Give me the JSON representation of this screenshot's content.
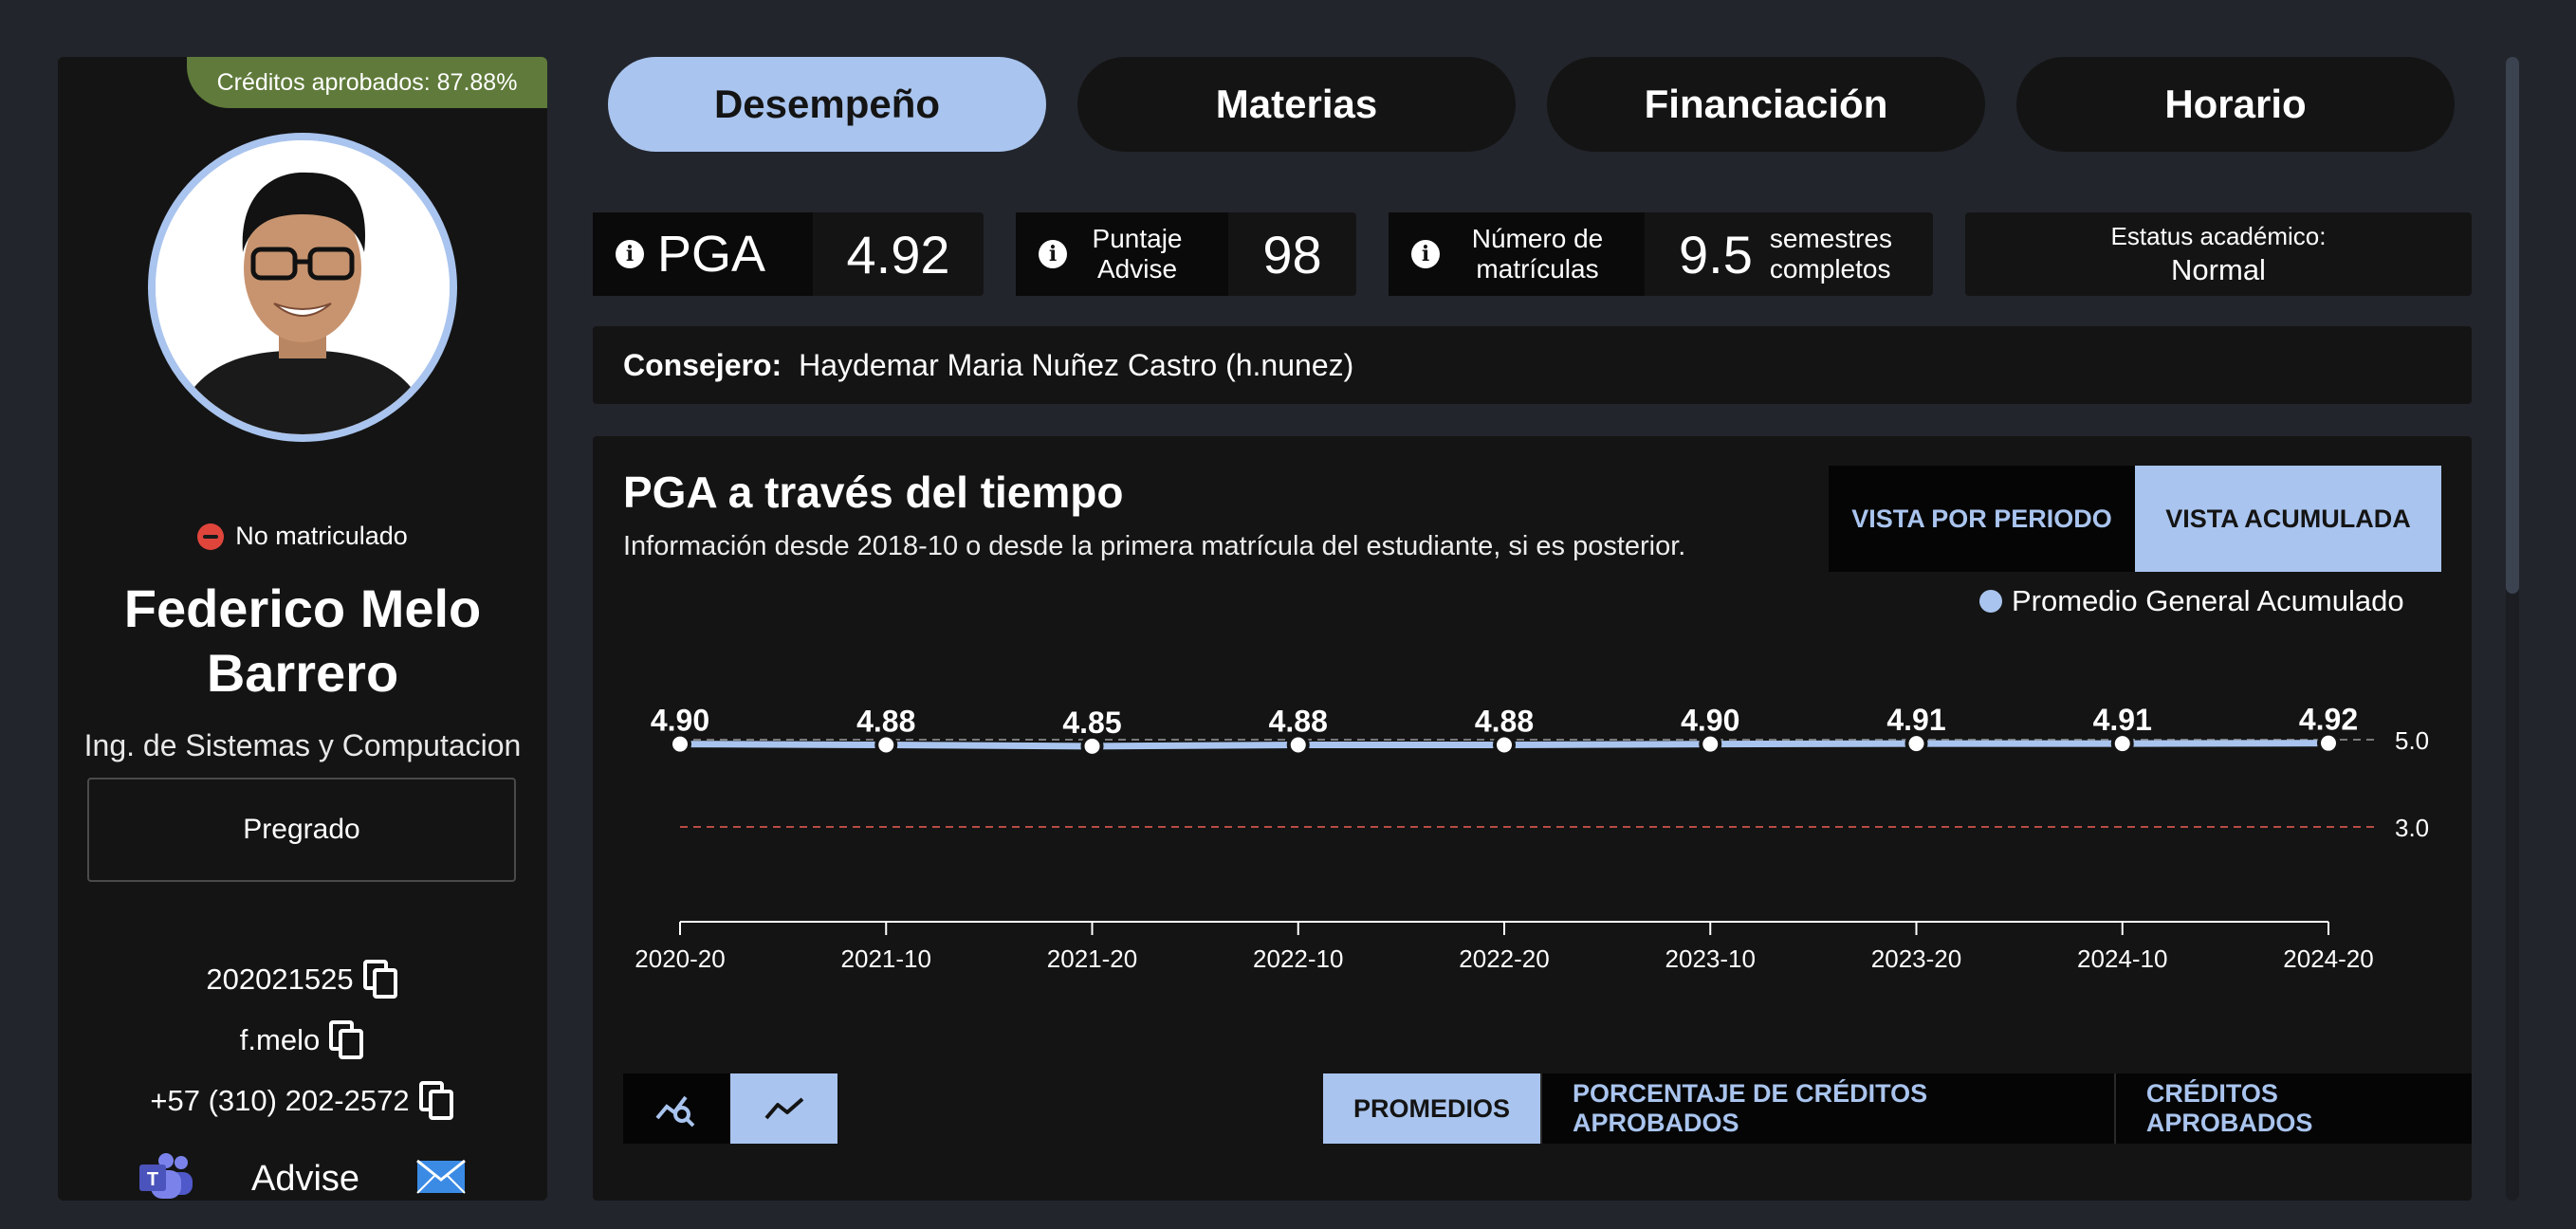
{
  "sidebar": {
    "credits_banner": "Créditos aprobados: 87.88%",
    "enrollment_status": "No matriculado",
    "name": "Federico Melo Barrero",
    "program": "Ing. de Sistemas y Computacion",
    "level": "Pregrado",
    "student_id": "202021525",
    "username": "f.melo",
    "phone": "+57 (310) 202-2572",
    "advise_label": "Advise"
  },
  "tabs": [
    "Desempeño",
    "Materias",
    "Financiación",
    "Horario"
  ],
  "stats": {
    "pga": {
      "label": "PGA",
      "value": "4.92"
    },
    "advise_score": {
      "label": "Puntaje Advise",
      "value": "98"
    },
    "enrollments": {
      "label": "Número de matrículas",
      "value": "9.5",
      "unit": "semestres completos"
    },
    "academic_status": {
      "label": "Estatus académico:",
      "value": "Normal"
    }
  },
  "advisor": {
    "label": "Consejero:",
    "value": "Haydemar Maria Nuñez Castro (h.nunez)"
  },
  "chart_panel": {
    "title": "PGA a través del tiempo",
    "subtitle": "Información desde 2018-10 o desde la primera matrícula del estudiante, si es posterior.",
    "view_period": "VISTA POR PERIODO",
    "view_cumulative": "VISTA ACUMULADA",
    "metric_tabs": [
      "PROMEDIOS",
      "PORCENTAJE DE CRÉDITOS APROBADOS",
      "CRÉDITOS APROBADOS"
    ]
  },
  "chart_data": {
    "type": "line",
    "x": [
      "2020-20",
      "2021-10",
      "2021-20",
      "2022-10",
      "2022-20",
      "2023-10",
      "2023-20",
      "2024-10",
      "2024-20"
    ],
    "series": [
      {
        "name": "Promedio General Acumulado",
        "values": [
          4.9,
          4.88,
          4.85,
          4.88,
          4.88,
          4.9,
          4.91,
          4.91,
          4.92
        ],
        "color": "#a9c4ee"
      }
    ],
    "data_labels": [
      "4.90",
      "4.88",
      "4.85",
      "4.88",
      "4.88",
      "4.90",
      "4.91",
      "4.91",
      "4.92"
    ],
    "reference_lines": [
      {
        "value": 5.0,
        "label": "5.0",
        "color": "#7a7a7a"
      },
      {
        "value": 3.0,
        "label": "3.0",
        "color": "#b84a44"
      }
    ]
  },
  "colors": {
    "accent": "#a9c4ee",
    "background": "#22252c",
    "panel": "#141414",
    "banner": "#5f7a3a"
  }
}
